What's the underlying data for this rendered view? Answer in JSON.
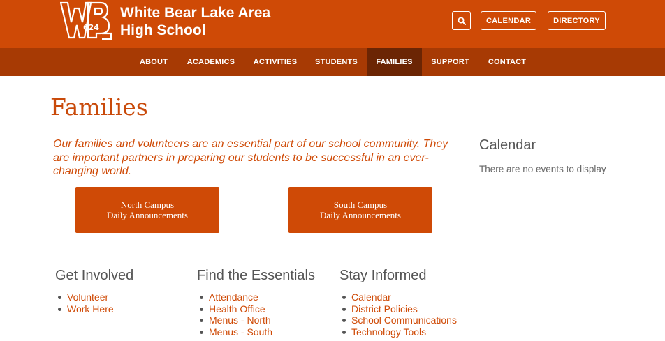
{
  "header": {
    "logo_text": "WBL 624",
    "school_name_line1": "White Bear Lake Area",
    "school_name_line2": "High School",
    "search_icon": "search-icon",
    "calendar_label": "CALENDAR",
    "directory_label": "DIRECTORY",
    "brand_color": "#cf4a06"
  },
  "nav": {
    "items": [
      {
        "label": "ABOUT"
      },
      {
        "label": "ACADEMICS"
      },
      {
        "label": "ACTIVITIES"
      },
      {
        "label": "STUDENTS"
      },
      {
        "label": "FAMILIES",
        "active": true
      },
      {
        "label": "SUPPORT"
      },
      {
        "label": "CONTACT"
      }
    ],
    "bar_color": "#a73a04",
    "active_color": "#6b2504"
  },
  "main": {
    "title": "Families",
    "intro": "Our families and volunteers are an essential part of our school community. They are important partners in preparing our students to be successful in an ever-changing world.",
    "buttons": [
      {
        "line1": "North Campus",
        "line2": "Daily Announcements"
      },
      {
        "line1": "South Campus",
        "line2": "Daily Announcements"
      }
    ]
  },
  "sidebar": {
    "title": "Calendar",
    "empty_text": "There are no events to display"
  },
  "sections": [
    {
      "title": "Get Involved",
      "links": [
        "Volunteer",
        "Work Here"
      ]
    },
    {
      "title": "Find the Essentials",
      "links": [
        "Attendance",
        "Health Office",
        "Menus - North",
        "Menus - South"
      ]
    },
    {
      "title": "Stay Informed",
      "links": [
        "Calendar",
        "District Policies",
        "School Communications",
        "Technology Tools"
      ]
    }
  ]
}
